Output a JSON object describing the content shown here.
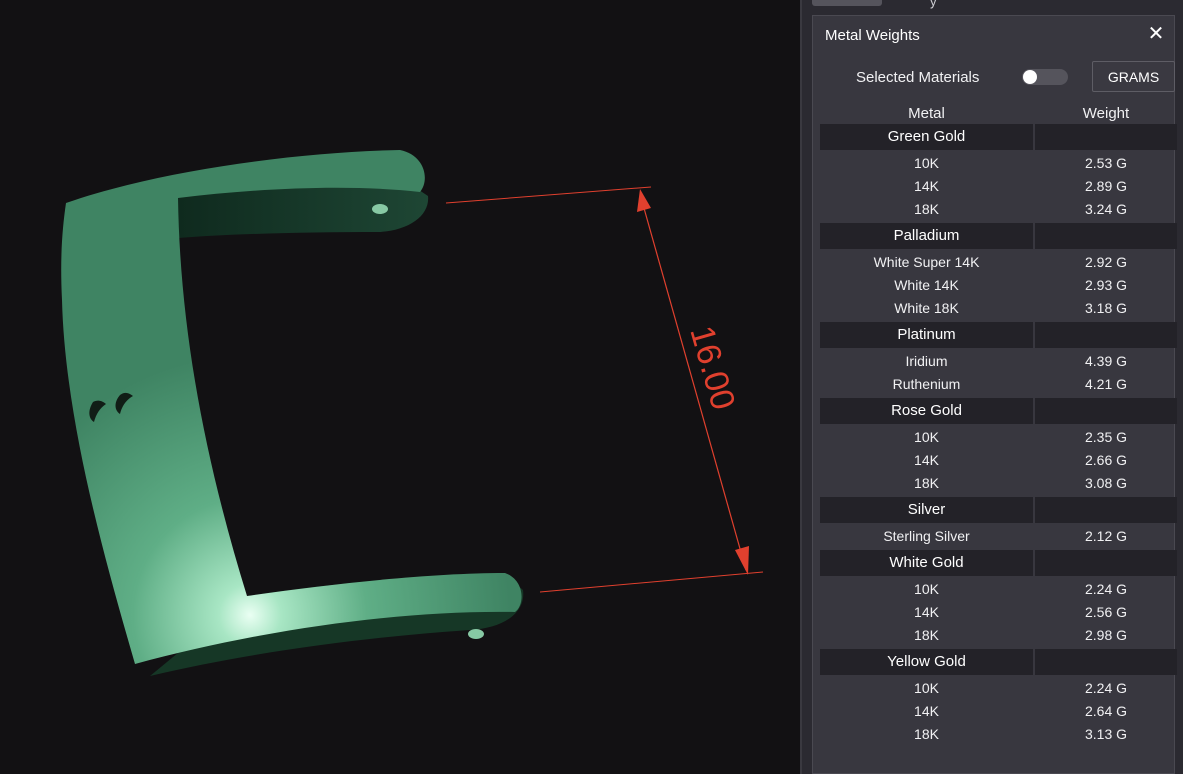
{
  "viewport": {
    "dimension_label": "16.00",
    "model_color": "#4f9a74",
    "dimension_color": "#e0402e"
  },
  "panel": {
    "title": "Metal Weights",
    "close_icon": "close-icon",
    "selected_label": "Selected Materials",
    "toggle_on": false,
    "unit_button": "GRAMS",
    "columns": [
      "Metal",
      "Weight"
    ],
    "groups": [
      {
        "name": "Green Gold",
        "rows": [
          {
            "metal": "10K",
            "weight": "2.53 G"
          },
          {
            "metal": "14K",
            "weight": "2.89 G"
          },
          {
            "metal": "18K",
            "weight": "3.24 G"
          }
        ]
      },
      {
        "name": "Palladium",
        "rows": [
          {
            "metal": "White Super 14K",
            "weight": "2.92 G"
          },
          {
            "metal": "White 14K",
            "weight": "2.93 G"
          },
          {
            "metal": "White 18K",
            "weight": "3.18 G"
          }
        ]
      },
      {
        "name": "Platinum",
        "rows": [
          {
            "metal": "Iridium",
            "weight": "4.39 G"
          },
          {
            "metal": "Ruthenium",
            "weight": "4.21 G"
          }
        ]
      },
      {
        "name": "Rose Gold",
        "rows": [
          {
            "metal": "10K",
            "weight": "2.35 G"
          },
          {
            "metal": "14K",
            "weight": "2.66 G"
          },
          {
            "metal": "18K",
            "weight": "3.08 G"
          }
        ]
      },
      {
        "name": "Silver",
        "rows": [
          {
            "metal": "Sterling Silver",
            "weight": "2.12 G"
          }
        ]
      },
      {
        "name": "White Gold",
        "rows": [
          {
            "metal": "10K",
            "weight": "2.24 G"
          },
          {
            "metal": "14K",
            "weight": "2.56 G"
          },
          {
            "metal": "18K",
            "weight": "2.98 G"
          }
        ]
      },
      {
        "name": "Yellow Gold",
        "rows": [
          {
            "metal": "10K",
            "weight": "2.24 G"
          },
          {
            "metal": "14K",
            "weight": "2.64 G"
          },
          {
            "metal": "18K",
            "weight": "3.13 G"
          }
        ]
      }
    ]
  }
}
